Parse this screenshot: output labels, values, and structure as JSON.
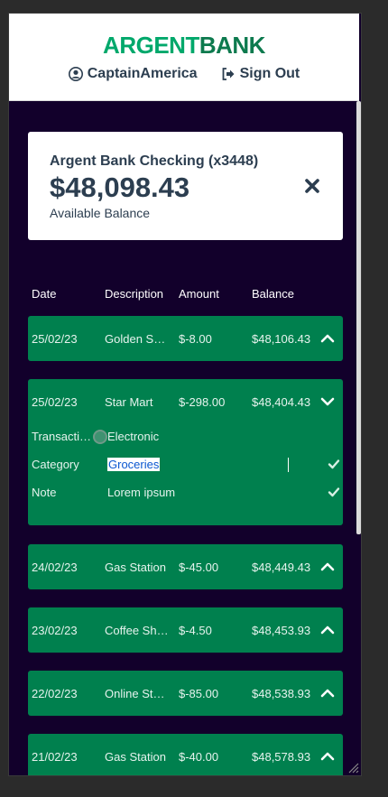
{
  "header": {
    "logo_part1": "ARGENT",
    "logo_part2": "BANK",
    "user_name": "CaptainAmerica",
    "sign_out_label": "Sign Out",
    "user_icon": "user-circle-icon",
    "sign_out_icon": "sign-out-icon"
  },
  "account": {
    "title": "Argent Bank Checking (x3448)",
    "amount": "$48,098.43",
    "description": "Available Balance",
    "close_icon": "close-icon"
  },
  "table": {
    "headers": {
      "date": "Date",
      "description": "Description",
      "amount": "Amount",
      "balance": "Balance"
    },
    "rows": [
      {
        "date": "25/02/23",
        "description": "Golden Sun Bakery",
        "amount": "$-8.00",
        "balance": "$48,106.43",
        "expanded": false
      },
      {
        "date": "25/02/23",
        "description": "Star Mart",
        "amount": "$-298.00",
        "balance": "$48,404.43",
        "expanded": true
      },
      {
        "date": "24/02/23",
        "description": "Gas Station",
        "amount": "$-45.00",
        "balance": "$48,449.43",
        "expanded": false
      },
      {
        "date": "23/02/23",
        "description": "Coffee Shop",
        "amount": "$-4.50",
        "balance": "$48,453.93",
        "expanded": false
      },
      {
        "date": "22/02/23",
        "description": "Online Store",
        "amount": "$-85.00",
        "balance": "$48,538.93",
        "expanded": false
      },
      {
        "date": "21/02/23",
        "description": "Gas Station",
        "amount": "$-40.00",
        "balance": "$48,578.93",
        "expanded": false
      }
    ],
    "details": {
      "transaction_type_label": "Transaction Type",
      "transaction_type_value": "Electronic",
      "category_label": "Category",
      "category_value": "Groceries",
      "note_label": "Note",
      "note_value": "Lorem ipsum"
    }
  },
  "colors": {
    "background": "#12002b",
    "row": "#00804e",
    "brand_green": "#00a86b",
    "text_dark": "#2c3e50"
  }
}
